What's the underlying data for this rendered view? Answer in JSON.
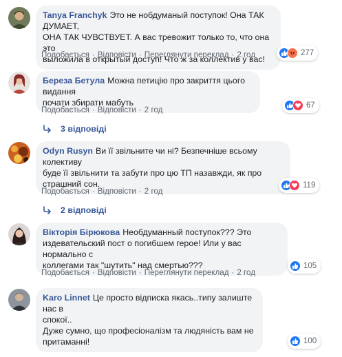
{
  "comments": [
    {
      "author": "Tanya Franchyk",
      "lines": [
        "Это не нобдуманый поступок! Она ТАК ДУМАЕТ,",
        "ОНА ТАК ЧУВСТВУЕТ. А вас тревожит только то, что она это",
        "выложила в открытый доступ! Что ж за коллектив у вас!"
      ],
      "actions": [
        "Подобається",
        "Відповісти",
        "Переглянути переклад",
        "2 год"
      ],
      "reaction_count": "277",
      "reactions": [
        "like-icon",
        "angry-icon"
      ]
    },
    {
      "author": "Береза Бетула",
      "lines": [
        "Можна петицію про закриття цього видання",
        "почати збирати мабуть"
      ],
      "actions": [
        "Подобається",
        "Відповісти",
        "2 год"
      ],
      "reaction_count": "67",
      "reactions": [
        "like-icon",
        "love-icon"
      ]
    },
    {
      "author": "Odyn Rusyn",
      "lines": [
        "Ви її звільните чи ні? Безпечніше всьому колективу",
        "буде її звільнити та забути про цю ТП назавжди, як про",
        "страшний сон."
      ],
      "actions": [
        "Подобається",
        "Відповісти",
        "2 год"
      ],
      "reaction_count": "119",
      "reactions": [
        "like-icon",
        "love-icon"
      ]
    },
    {
      "author": "Вікторія Бірюкова",
      "lines": [
        "Необдуманный поступок??? Это",
        "издевательский пост о погибшем герое! Или у вас нормально с",
        "коллегами так \"шутить\" над смертью???"
      ],
      "actions": [
        "Подобається",
        "Відповісти",
        "Переглянути переклад",
        "2 год"
      ],
      "reaction_count": "105",
      "reactions": [
        "like-icon"
      ]
    },
    {
      "author": "Karo Linnet",
      "lines": [
        "Це просто відписка якась..типу залиште нас в",
        "спокої..",
        "Дуже сумно, що професіоналізм та людяність вам не",
        "притаманні!"
      ],
      "actions": [],
      "reaction_count": "100",
      "reactions": [
        "like-icon"
      ]
    }
  ],
  "replies": [
    {
      "label": "3 відповіді"
    },
    {
      "label": "2 відповіді"
    }
  ],
  "colors": {
    "author": "#385898",
    "bubble_bg": "#f2f3f5",
    "like": "#2078f4",
    "love": "#f33e58",
    "angry": "#f7714c",
    "meta": "#606770"
  }
}
